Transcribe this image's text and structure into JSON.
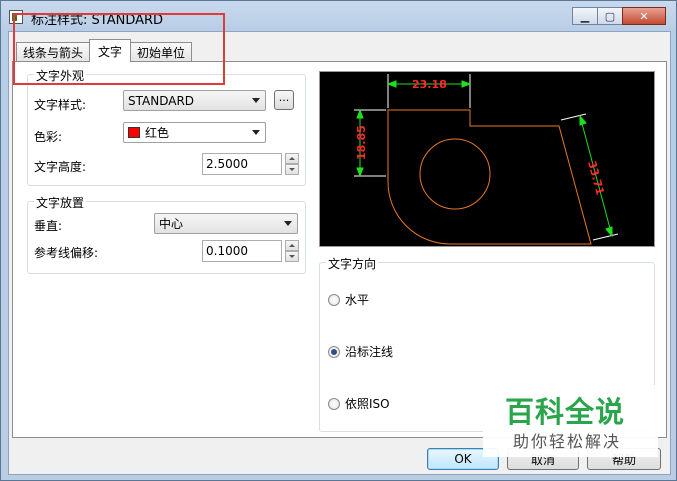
{
  "window": {
    "title": "标注样式: STANDARD",
    "minimize": "▁",
    "maximize": "▢",
    "close": "✕"
  },
  "tabs": [
    {
      "label": "线条与箭头"
    },
    {
      "label": "文字"
    },
    {
      "label": "初始单位"
    }
  ],
  "appearance": {
    "title": "文字外观",
    "style_label": "文字样式:",
    "style_value": "STANDARD",
    "style_browse": "...",
    "color_label": "色彩:",
    "color_value": "红色",
    "color_hex": "#ff0000",
    "height_label": "文字高度:",
    "height_value": "2.5000"
  },
  "placement": {
    "title": "文字放置",
    "vertical_label": "垂直:",
    "vertical_value": "中心",
    "offset_label": "参考线偏移:",
    "offset_value": "0.1000"
  },
  "preview": {
    "dim_top": "23.18",
    "dim_left": "18.85",
    "dim_right": "33.71"
  },
  "direction": {
    "title": "文字方向",
    "options": [
      {
        "label": "水平",
        "checked": false
      },
      {
        "label": "沿标注线",
        "checked": true
      },
      {
        "label": "依照ISO",
        "checked": false
      }
    ]
  },
  "buttons": {
    "ok": "OK",
    "cancel": "取消",
    "help": "帮助"
  },
  "watermark": {
    "top": "百科全说",
    "bottom": "助你轻松解决"
  }
}
